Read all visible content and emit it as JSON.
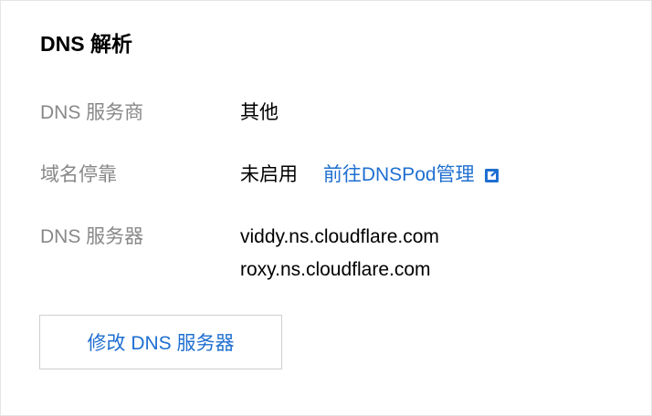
{
  "section": {
    "title": "DNS 解析"
  },
  "rows": [
    {
      "label": "DNS 服务商",
      "value": "其他"
    },
    {
      "label": "域名停靠",
      "value": "未启用",
      "link_text": "前往DNSPod管理",
      "link_icon": "external-link-icon"
    },
    {
      "label": "DNS 服务器",
      "values": [
        "viddy.ns.cloudflare.com",
        "roxy.ns.cloudflare.com"
      ]
    }
  ],
  "actions": {
    "modify_dns_label": "修改 DNS 服务器"
  },
  "colors": {
    "link": "#1f6fd1",
    "label": "#888888",
    "text": "#000000"
  }
}
